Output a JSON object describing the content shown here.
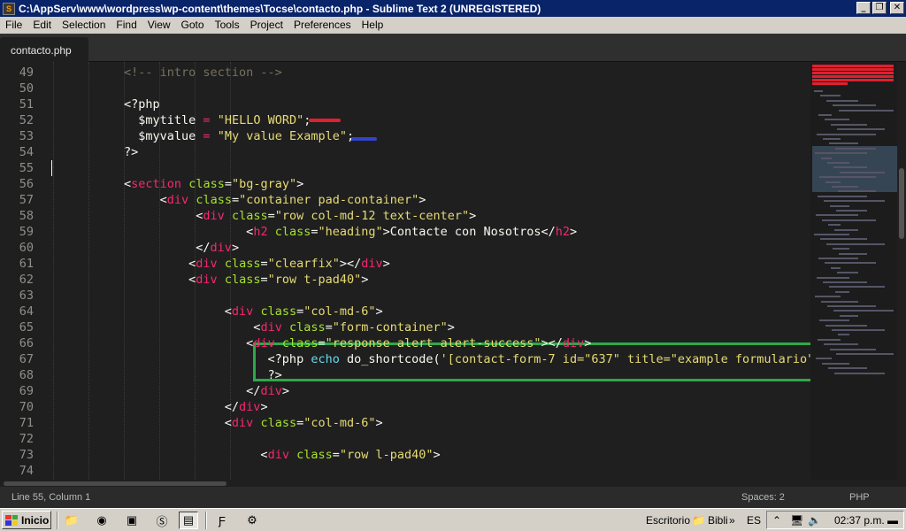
{
  "window": {
    "title": "C:\\AppServ\\www\\wordpress\\wp-content\\themes\\Tocse\\contacto.php - Sublime Text 2 (UNREGISTERED)",
    "minimize_glyph": "_",
    "maximize_glyph": "❐",
    "close_glyph": "✕"
  },
  "menu": [
    "File",
    "Edit",
    "Selection",
    "Find",
    "View",
    "Goto",
    "Tools",
    "Project",
    "Preferences",
    "Help"
  ],
  "tab": {
    "label": "contacto.php"
  },
  "editor": {
    "line_numbers": [
      "49",
      "50",
      "51",
      "52",
      "53",
      "54",
      "55",
      "56",
      "57",
      "58",
      "59",
      "60",
      "61",
      "62",
      "63",
      "64",
      "65",
      "66",
      "67",
      "68",
      "69",
      "70",
      "71",
      "72",
      "73",
      "74"
    ],
    "lines": [
      [
        {
          "c": "cm",
          "t": "<!-- intro section -->"
        }
      ],
      [],
      [
        {
          "c": "pl",
          "t": "<?php"
        }
      ],
      [
        {
          "c": "pl",
          "t": "  $mytitle "
        },
        {
          "c": "op",
          "t": "="
        },
        {
          "c": "pl",
          "t": " "
        },
        {
          "c": "str",
          "t": "\"HELLO WORD\""
        },
        {
          "c": "pl",
          "t": ";"
        }
      ],
      [
        {
          "c": "pl",
          "t": "  $myvalue "
        },
        {
          "c": "op",
          "t": "="
        },
        {
          "c": "pl",
          "t": " "
        },
        {
          "c": "str",
          "t": "\"My value Example\""
        },
        {
          "c": "pl",
          "t": ";"
        }
      ],
      [
        {
          "c": "pl",
          "t": "?>"
        }
      ],
      [],
      [
        {
          "c": "pl",
          "t": "<"
        },
        {
          "c": "tag",
          "t": "section"
        },
        {
          "c": "pl",
          "t": " "
        },
        {
          "c": "attr",
          "t": "class"
        },
        {
          "c": "pl",
          "t": "="
        },
        {
          "c": "str",
          "t": "\"bg-gray\""
        },
        {
          "c": "pl",
          "t": ">"
        }
      ],
      [
        {
          "c": "pl",
          "t": "     <"
        },
        {
          "c": "tag",
          "t": "div"
        },
        {
          "c": "pl",
          "t": " "
        },
        {
          "c": "attr",
          "t": "class"
        },
        {
          "c": "pl",
          "t": "="
        },
        {
          "c": "str",
          "t": "\"container pad-container\""
        },
        {
          "c": "pl",
          "t": ">"
        }
      ],
      [
        {
          "c": "pl",
          "t": "          <"
        },
        {
          "c": "tag",
          "t": "div"
        },
        {
          "c": "pl",
          "t": " "
        },
        {
          "c": "attr",
          "t": "class"
        },
        {
          "c": "pl",
          "t": "="
        },
        {
          "c": "str",
          "t": "\"row col-md-12 text-center\""
        },
        {
          "c": "pl",
          "t": ">"
        }
      ],
      [
        {
          "c": "pl",
          "t": "                 <"
        },
        {
          "c": "tag",
          "t": "h2"
        },
        {
          "c": "pl",
          "t": " "
        },
        {
          "c": "attr",
          "t": "class"
        },
        {
          "c": "pl",
          "t": "="
        },
        {
          "c": "str",
          "t": "\"heading\""
        },
        {
          "c": "pl",
          "t": ">Contacte con Nosotros</"
        },
        {
          "c": "tag",
          "t": "h2"
        },
        {
          "c": "pl",
          "t": ">"
        }
      ],
      [
        {
          "c": "pl",
          "t": "          </"
        },
        {
          "c": "tag",
          "t": "div"
        },
        {
          "c": "pl",
          "t": ">"
        }
      ],
      [
        {
          "c": "pl",
          "t": "         <"
        },
        {
          "c": "tag",
          "t": "div"
        },
        {
          "c": "pl",
          "t": " "
        },
        {
          "c": "attr",
          "t": "class"
        },
        {
          "c": "pl",
          "t": "="
        },
        {
          "c": "str",
          "t": "\"clearfix\""
        },
        {
          "c": "pl",
          "t": "></"
        },
        {
          "c": "tag",
          "t": "div"
        },
        {
          "c": "pl",
          "t": ">"
        }
      ],
      [
        {
          "c": "pl",
          "t": "         <"
        },
        {
          "c": "tag",
          "t": "div"
        },
        {
          "c": "pl",
          "t": " "
        },
        {
          "c": "attr",
          "t": "class"
        },
        {
          "c": "pl",
          "t": "="
        },
        {
          "c": "str",
          "t": "\"row t-pad40\""
        },
        {
          "c": "pl",
          "t": ">"
        }
      ],
      [],
      [
        {
          "c": "pl",
          "t": "              <"
        },
        {
          "c": "tag",
          "t": "div"
        },
        {
          "c": "pl",
          "t": " "
        },
        {
          "c": "attr",
          "t": "class"
        },
        {
          "c": "pl",
          "t": "="
        },
        {
          "c": "str",
          "t": "\"col-md-6\""
        },
        {
          "c": "pl",
          "t": ">"
        }
      ],
      [
        {
          "c": "pl",
          "t": "                  <"
        },
        {
          "c": "tag",
          "t": "div"
        },
        {
          "c": "pl",
          "t": " "
        },
        {
          "c": "attr",
          "t": "class"
        },
        {
          "c": "pl",
          "t": "="
        },
        {
          "c": "str",
          "t": "\"form-container\""
        },
        {
          "c": "pl",
          "t": ">"
        }
      ],
      [
        {
          "c": "pl",
          "t": "                 <"
        },
        {
          "c": "tag",
          "t": "div"
        },
        {
          "c": "pl",
          "t": " "
        },
        {
          "c": "attr",
          "t": "class"
        },
        {
          "c": "pl",
          "t": "="
        },
        {
          "c": "str",
          "t": "\"response alert alert-success\""
        },
        {
          "c": "pl",
          "t": "></"
        },
        {
          "c": "tag",
          "t": "div"
        },
        {
          "c": "pl",
          "t": ">"
        }
      ],
      [
        {
          "c": "pl",
          "t": "                    <?php "
        },
        {
          "c": "kw",
          "t": "echo"
        },
        {
          "c": "pl",
          "t": " do_shortcode("
        },
        {
          "c": "str",
          "t": "'[contact-form-7 id=\"637\" title=\"example formulario\"'"
        }
      ],
      [
        {
          "c": "pl",
          "t": "                    ?>"
        }
      ],
      [
        {
          "c": "pl",
          "t": "                 </"
        },
        {
          "c": "tag",
          "t": "div"
        },
        {
          "c": "pl",
          "t": ">"
        }
      ],
      [
        {
          "c": "pl",
          "t": "              </"
        },
        {
          "c": "tag",
          "t": "div"
        },
        {
          "c": "pl",
          "t": ">"
        }
      ],
      [
        {
          "c": "pl",
          "t": "              <"
        },
        {
          "c": "tag",
          "t": "div"
        },
        {
          "c": "pl",
          "t": " "
        },
        {
          "c": "attr",
          "t": "class"
        },
        {
          "c": "pl",
          "t": "="
        },
        {
          "c": "str",
          "t": "\"col-md-6\""
        },
        {
          "c": "pl",
          "t": ">"
        }
      ],
      [],
      [
        {
          "c": "pl",
          "t": "                   <"
        },
        {
          "c": "tag",
          "t": "div"
        },
        {
          "c": "pl",
          "t": " "
        },
        {
          "c": "attr",
          "t": "class"
        },
        {
          "c": "pl",
          "t": "="
        },
        {
          "c": "str",
          "t": "\"row l-pad40\""
        },
        {
          "c": "pl",
          "t": ">"
        }
      ],
      []
    ]
  },
  "status": {
    "position": "Line 55, Column 1",
    "indent": "Spaces: 2",
    "syntax": "PHP"
  },
  "taskbar": {
    "start_label": "Inicio",
    "desktop_label": "Escritorio",
    "library_label": "Bibli",
    "language": "ES",
    "clock": "02:37 p.m.",
    "icons": [
      "folder-icon",
      "chrome-icon",
      "network-icon",
      "skype-icon",
      "sublime-icon",
      "filezilla-icon",
      "tool-icon"
    ]
  },
  "colors": {
    "editor_bg": "#1f1f1f",
    "annotation_red": "#e02030",
    "annotation_blue": "#3344cc",
    "annotation_box": "#2ea84a"
  }
}
